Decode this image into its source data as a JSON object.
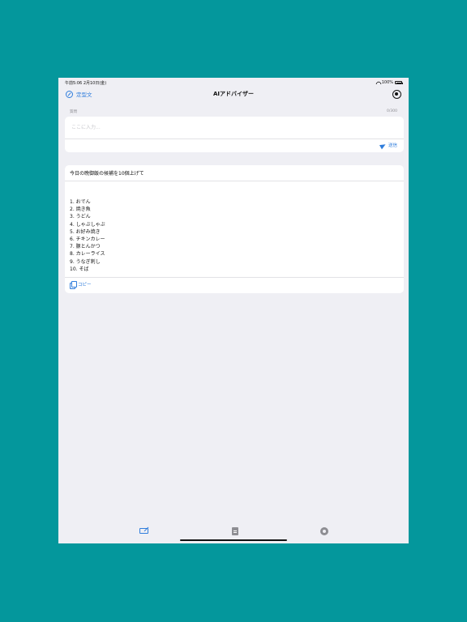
{
  "status_bar": {
    "time_date": "午前5:06  2月10日(金)",
    "battery": "100%"
  },
  "nav": {
    "left_label": "定型文",
    "title": "AIアドバイザー"
  },
  "input": {
    "label": "質問",
    "char_count": "0/300",
    "placeholder": "ここに入力...",
    "value": "",
    "send_label": "送信"
  },
  "result": {
    "prompt": "今日の晩御飯の候補を10個上げて",
    "answers": [
      "1. おでん",
      "2. 焼き魚",
      "3. うどん",
      "4. しゃぶしゃぶ",
      "5. お好み焼き",
      "6. チキンカレー",
      "7. 豚とんかつ",
      "8. カレーライス",
      "9. うなぎ刺し",
      "10. そば"
    ],
    "copy_label": "コピー"
  },
  "tabs": [
    {
      "icon": "chat-compose-icon",
      "active": true
    },
    {
      "icon": "document-icon",
      "active": false
    },
    {
      "icon": "gear-icon",
      "active": false
    }
  ],
  "colors": {
    "background": "#04979c",
    "accent": "#2f7ddc",
    "screen": "#efeff4"
  }
}
